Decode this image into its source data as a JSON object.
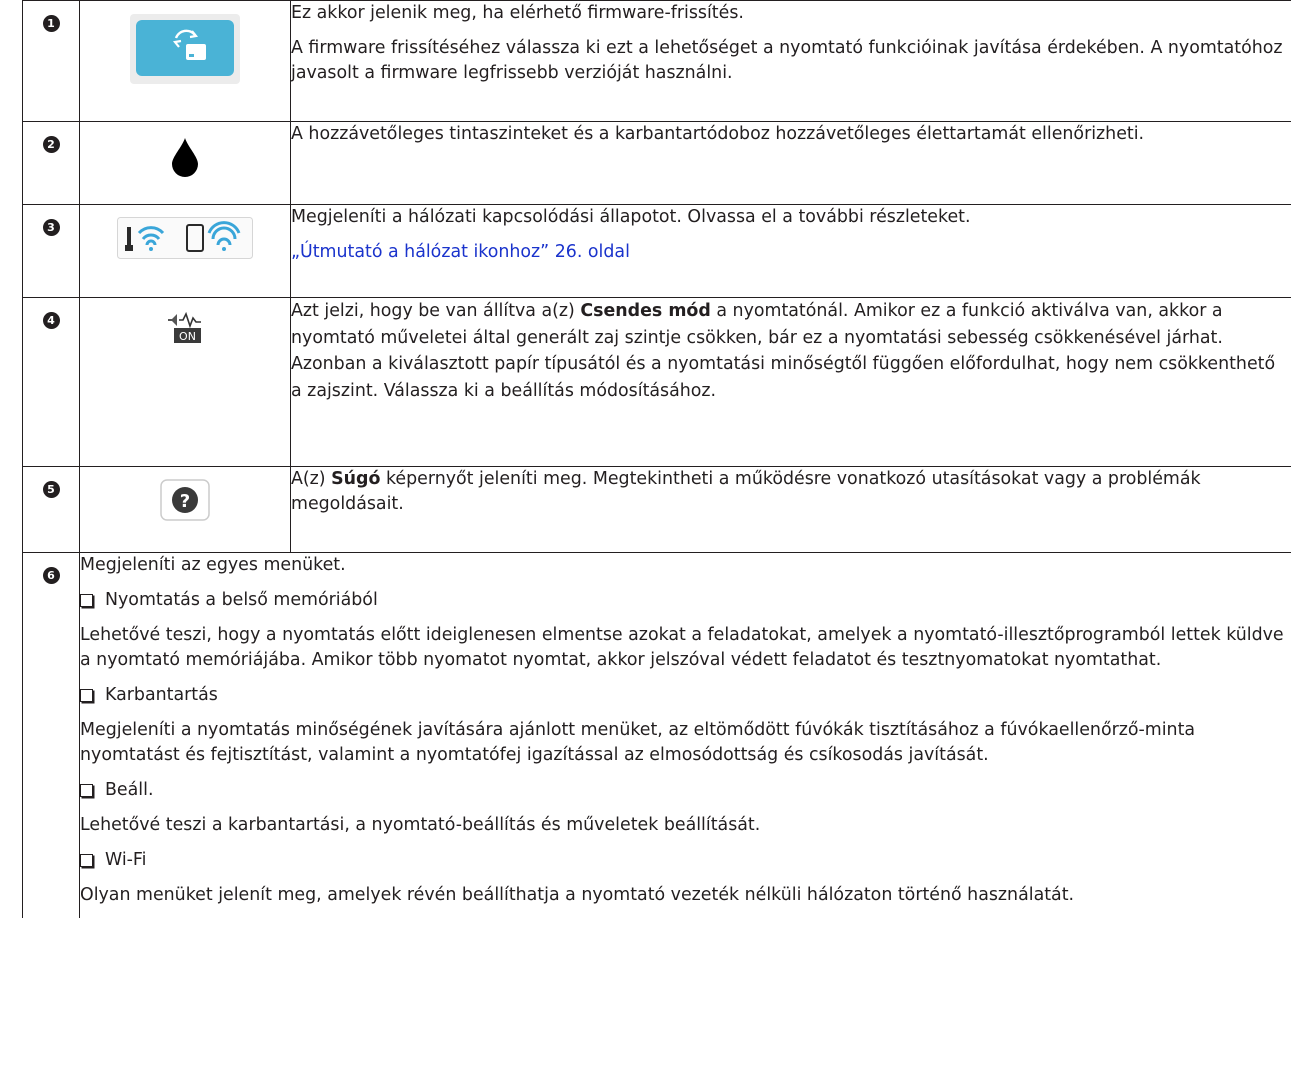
{
  "rows": [
    {
      "number": "1",
      "icon": "firmware-update-icon",
      "lines": [
        "Ez akkor jelenik meg, ha elérhető firmware-frissítés.",
        "A firmware frissítéséhez válassza ki ezt a lehetőséget a nyomtató funkcióinak javítása érdekében. A nyomtatóhoz javasolt a firmware legfrissebb verzióját használni."
      ]
    },
    {
      "number": "2",
      "icon": "ink-drop-icon",
      "lines": [
        "A hozzávetőleges tintaszinteket és a karbantartódoboz hozzávetőleges élettartamát ellenőrizheti."
      ]
    },
    {
      "number": "3",
      "icon": "network-status-icon",
      "lines": [
        "Megjeleníti a hálózati kapcsolódási állapotot. Olvassa el a további részleteket."
      ],
      "link": "„Útmutató a hálózat ikonhoz” 26. oldal"
    },
    {
      "number": "4",
      "icon": "quiet-mode-on-icon",
      "text_before": "Azt jelzi, hogy be van állítva a(z) ",
      "bold": "Csendes mód",
      "text_after": " a nyomtatónál. Amikor ez a funkció aktiválva van, akkor a nyomtató műveletei által generált zaj szintje csökken, bár ez a nyomtatási sebesség csökkenésével járhat. Azonban a kiválasztott papír típusától és a nyomtatási minőségtől függően előfordulhat, hogy nem csökkenthető a zajszint. Válassza ki a beállítás módosításához."
    },
    {
      "number": "5",
      "icon": "help-icon",
      "text_before": "A(z) ",
      "bold": "Súgó",
      "text_after": " képernyőt jeleníti meg. Megtekintheti a működésre vonatkozó utasításokat vagy a problémák megoldásait."
    }
  ],
  "row6": {
    "number": "6",
    "intro": "Megjeleníti az egyes menüket.",
    "items": [
      {
        "title": "Nyomtatás a belső memóriából",
        "desc": "Lehetővé teszi, hogy a nyomtatás előtt ideiglenesen elmentse azokat a feladatokat, amelyek a nyomtató-illesztőprogramból lettek küldve a nyomtató memóriájába. Amikor több nyomatot nyomtat, akkor jelszóval védett feladatot és tesztnyomatokat nyomtathat."
      },
      {
        "title": "Karbantartás",
        "desc": "Megjeleníti a nyomtatás minőségének javítására ajánlott menüket, az eltömődött fúvókák tisztításához a fúvókaellenőrző-minta nyomtatást és fejtisztítást, valamint a nyomtatófej igazítással az elmosódottság és csíkosodás javítását."
      },
      {
        "title": "Beáll.",
        "desc": "Lehetővé teszi a karbantartási, a nyomtató-beállítás és műveletek beállítását."
      },
      {
        "title": "Wi-Fi",
        "desc": "Olyan menüket jelenít meg, amelyek révén beállíthatja a nyomtató vezeték nélküli hálózaton történő használatát."
      }
    ]
  },
  "colors": {
    "text": "#231f20",
    "link": "#1a33cc",
    "icon_blue": "#4ab3d6",
    "wifi_blue": "#3aa6d9"
  }
}
